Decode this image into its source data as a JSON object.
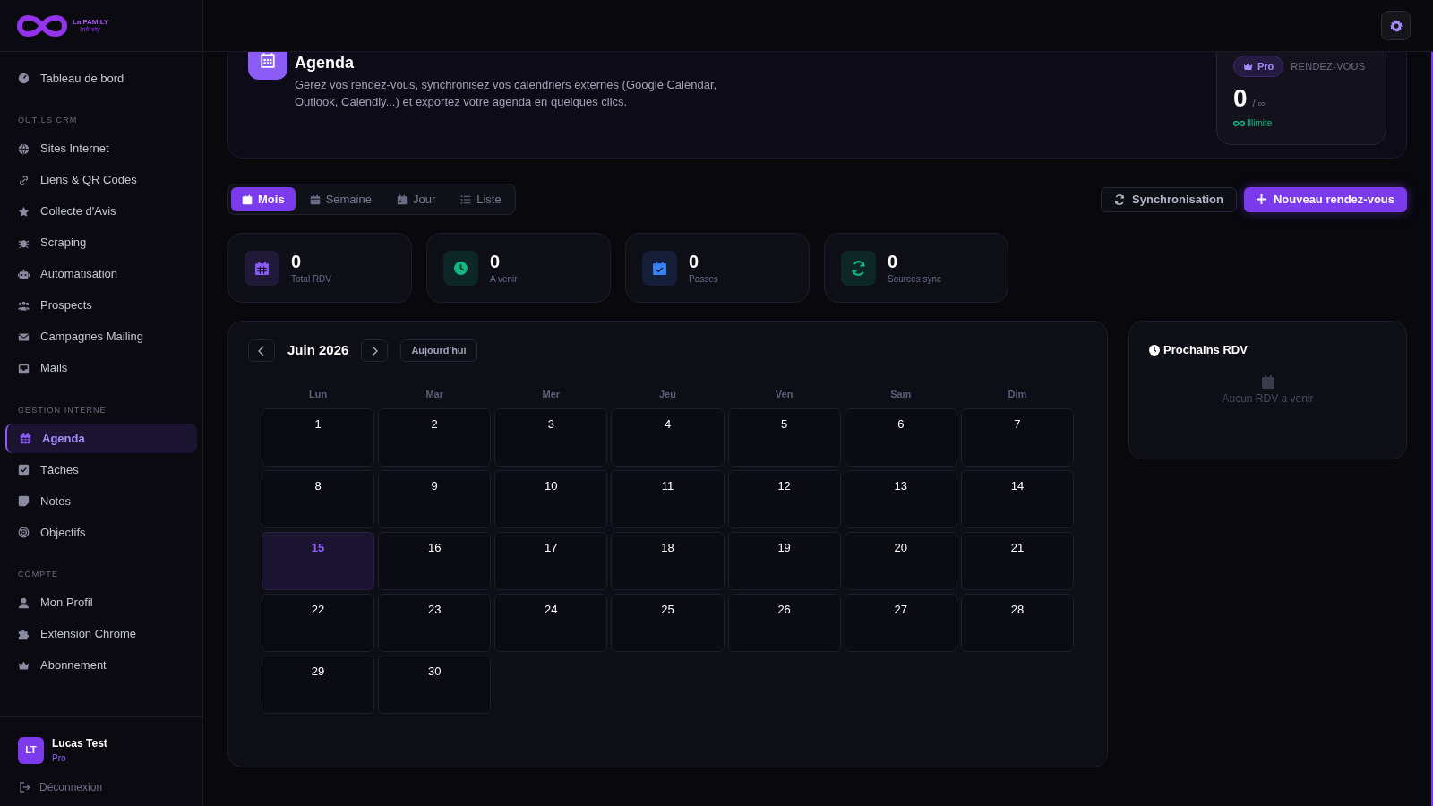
{
  "brand": {
    "name": "La FAMILY",
    "tagline": "Infinity"
  },
  "sidebar": {
    "top_items": [
      {
        "label": "Tableau de bord",
        "selected": false
      }
    ],
    "sections": [
      {
        "title": "OUTILS CRM",
        "items": [
          {
            "label": "Sites Internet",
            "selected": false
          },
          {
            "label": "Liens & QR Codes",
            "selected": false
          },
          {
            "label": "Collecte d'Avis",
            "selected": false
          },
          {
            "label": "Scraping",
            "selected": false
          },
          {
            "label": "Automatisation",
            "selected": false
          },
          {
            "label": "Prospects",
            "selected": false
          },
          {
            "label": "Campagnes Mailing",
            "selected": false
          },
          {
            "label": "Mails",
            "selected": false
          }
        ]
      },
      {
        "title": "GESTION INTERNE",
        "items": [
          {
            "label": "Agenda",
            "selected": true
          },
          {
            "label": "Tâches",
            "selected": false
          },
          {
            "label": "Notes",
            "selected": false
          },
          {
            "label": "Objectifs",
            "selected": false
          }
        ]
      },
      {
        "title": "COMPTE",
        "items": [
          {
            "label": "Mon Profil",
            "selected": false
          },
          {
            "label": "Extension Chrome",
            "selected": false
          },
          {
            "label": "Abonnement",
            "selected": false
          }
        ]
      }
    ],
    "user": {
      "initials": "LT",
      "name": "Lucas Test",
      "plan": "Pro"
    },
    "logout": "Déconnexion"
  },
  "header": {
    "title": "Agenda",
    "description": "Gerez vos rendez-vous, synchronisez vos calendriers externes (Google Calendar, Outlook, Calendly...) et exportez votre agenda en quelques clics.",
    "quota": {
      "badge": "Pro",
      "label": "RENDEZ-VOUS",
      "value": "0",
      "limit": "/ ∞",
      "note": "Illimite"
    }
  },
  "view_tabs": [
    {
      "label": "Mois",
      "selected": true
    },
    {
      "label": "Semaine",
      "selected": false
    },
    {
      "label": "Jour",
      "selected": false
    },
    {
      "label": "Liste",
      "selected": false
    }
  ],
  "actions": [
    "Synchronisation",
    "Nouveau rendez-vous"
  ],
  "stats": [
    {
      "value": "0",
      "label": "Total RDV",
      "color": "#8b5cf6"
    },
    {
      "value": "0",
      "label": "A venir",
      "color": "#10b981"
    },
    {
      "value": "0",
      "label": "Passes",
      "color": "#3b82f6"
    },
    {
      "value": "0",
      "label": "Sources sync",
      "color": "#10b981"
    }
  ],
  "calendar": {
    "month": "Juin 2026",
    "today_button": "Aujourd'hui",
    "weekdays": [
      "Lun",
      "Mar",
      "Mer",
      "Jeu",
      "Ven",
      "Sam",
      "Dim"
    ],
    "days": [
      {
        "day": "1",
        "selected": false
      },
      {
        "day": "2",
        "selected": false
      },
      {
        "day": "3",
        "selected": false
      },
      {
        "day": "4",
        "selected": false
      },
      {
        "day": "5",
        "selected": false
      },
      {
        "day": "6",
        "selected": false
      },
      {
        "day": "7",
        "selected": false
      },
      {
        "day": "8",
        "selected": false
      },
      {
        "day": "9",
        "selected": false
      },
      {
        "day": "10",
        "selected": false
      },
      {
        "day": "11",
        "selected": false
      },
      {
        "day": "12",
        "selected": false
      },
      {
        "day": "13",
        "selected": false
      },
      {
        "day": "14",
        "selected": false
      },
      {
        "day": "15",
        "selected": true
      },
      {
        "day": "16",
        "selected": false
      },
      {
        "day": "17",
        "selected": false
      },
      {
        "day": "18",
        "selected": false
      },
      {
        "day": "19",
        "selected": false
      },
      {
        "day": "20",
        "selected": false
      },
      {
        "day": "21",
        "selected": false
      },
      {
        "day": "22",
        "selected": false
      },
      {
        "day": "23",
        "selected": false
      },
      {
        "day": "24",
        "selected": false
      },
      {
        "day": "25",
        "selected": false
      },
      {
        "day": "26",
        "selected": false
      },
      {
        "day": "27",
        "selected": false
      },
      {
        "day": "28",
        "selected": false
      },
      {
        "day": "29",
        "selected": false
      },
      {
        "day": "30",
        "selected": false
      }
    ]
  },
  "upcoming": {
    "title": "Prochains RDV",
    "empty": "Aucun RDV a venir"
  }
}
